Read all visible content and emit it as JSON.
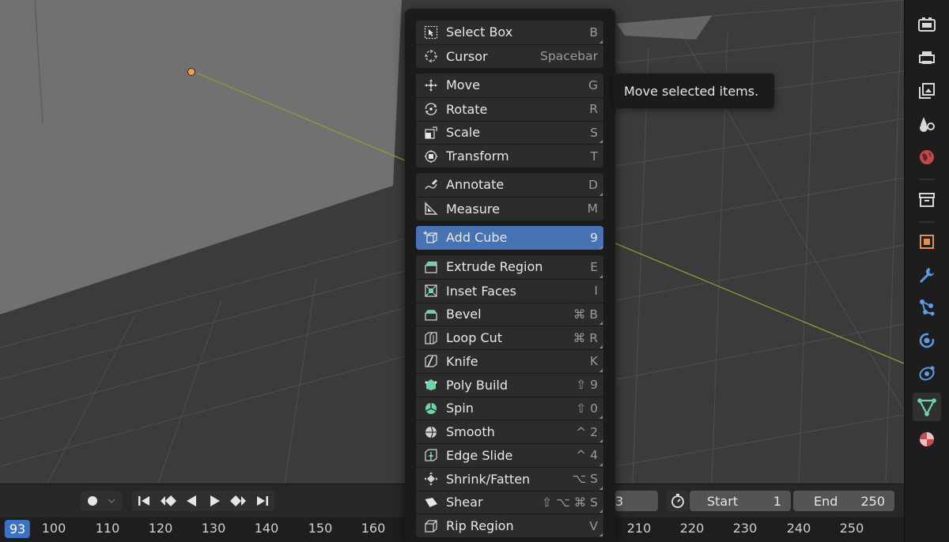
{
  "menu": {
    "groups": [
      {
        "items": [
          {
            "label": "Select Box",
            "key": "B",
            "icon": "select-box-icon",
            "corner": true
          },
          {
            "label": "Cursor",
            "key": "Spacebar",
            "icon": "cursor-icon",
            "corner": false
          }
        ]
      },
      {
        "items": [
          {
            "label": "Move",
            "key": "G",
            "icon": "move-icon",
            "corner": false
          },
          {
            "label": "Rotate",
            "key": "R",
            "icon": "rotate-icon",
            "corner": false
          },
          {
            "label": "Scale",
            "key": "S",
            "icon": "scale-icon",
            "corner": true
          },
          {
            "label": "Transform",
            "key": "T",
            "icon": "transform-icon",
            "corner": false
          }
        ]
      },
      {
        "items": [
          {
            "label": "Annotate",
            "key": "D",
            "icon": "annotate-icon",
            "corner": true
          },
          {
            "label": "Measure",
            "key": "M",
            "icon": "measure-icon",
            "corner": false
          }
        ]
      },
      {
        "items": [
          {
            "label": "Add Cube",
            "key": "9",
            "icon": "add-cube-icon",
            "corner": true,
            "selected": true
          }
        ]
      },
      {
        "items": [
          {
            "label": "Extrude Region",
            "key": "E",
            "icon": "extrude-region-icon",
            "corner": true
          },
          {
            "label": "Inset Faces",
            "key": "I",
            "icon": "inset-faces-icon",
            "corner": false
          },
          {
            "label": "Bevel",
            "key": "⌘ B",
            "icon": "bevel-icon",
            "corner": true
          },
          {
            "label": "Loop Cut",
            "key": "⌘ R",
            "icon": "loop-cut-icon",
            "corner": true
          },
          {
            "label": "Knife",
            "key": "K",
            "icon": "knife-icon",
            "corner": true
          },
          {
            "label": "Poly Build",
            "key": "⇧ 9",
            "icon": "poly-build-icon",
            "corner": false
          },
          {
            "label": "Spin",
            "key": "⇧ 0",
            "icon": "spin-icon",
            "corner": true
          },
          {
            "label": "Smooth",
            "key": "^ 2",
            "icon": "smooth-icon",
            "corner": true
          },
          {
            "label": "Edge Slide",
            "key": "^ 4",
            "icon": "edge-slide-icon",
            "corner": true
          },
          {
            "label": "Shrink/Fatten",
            "key": "⌥ S",
            "icon": "shrink-fatten-icon",
            "corner": true
          },
          {
            "label": "Shear",
            "key": "⇧ ⌥ ⌘ S",
            "icon": "shear-icon",
            "corner": true
          },
          {
            "label": "Rip Region",
            "key": "V",
            "icon": "rip-region-icon",
            "corner": true
          }
        ]
      }
    ]
  },
  "tooltip": {
    "text": "Move selected items."
  },
  "timeline": {
    "current_frame": "93",
    "partial_frame_field": "3",
    "start_label": "Start",
    "start_value": "1",
    "end_label": "End",
    "end_value": "250",
    "ticks_left": [
      "100",
      "110",
      "120",
      "130",
      "140",
      "150",
      "160"
    ],
    "ticks_right": [
      "210",
      "220",
      "230",
      "240",
      "250"
    ]
  },
  "colors": {
    "selection": "#4772b3",
    "menu_bg": "#1b1b1b",
    "item_bg": "#2c2c2c",
    "accent_mesh": "#6dd6a8",
    "object_origin": "#f0a356"
  }
}
